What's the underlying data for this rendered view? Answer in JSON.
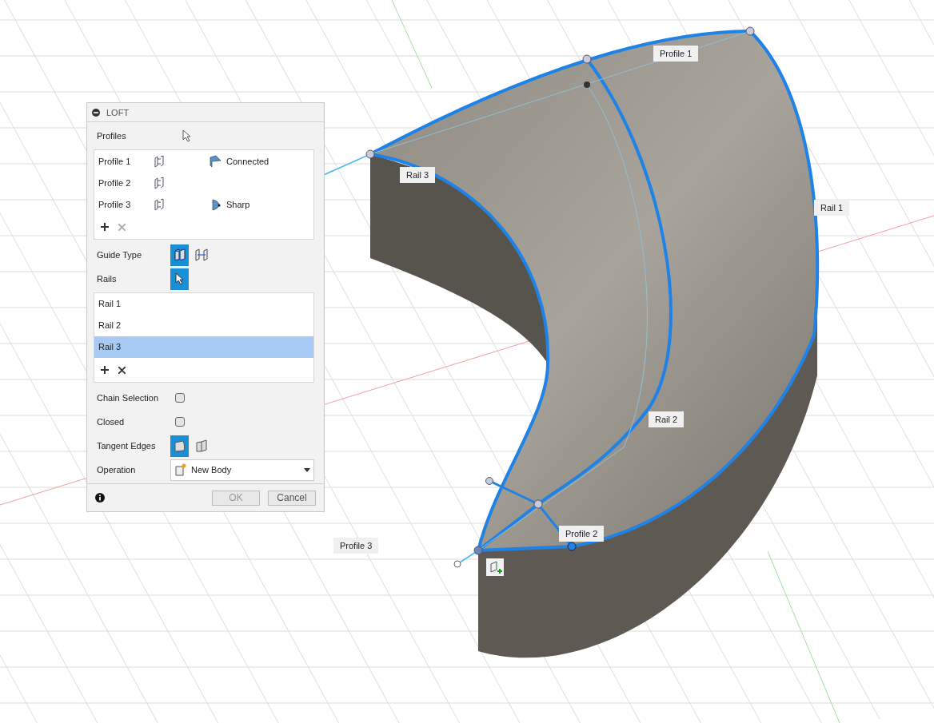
{
  "viewport": {
    "callouts": [
      {
        "label": "Profile 1"
      },
      {
        "label": "Rail 3"
      },
      {
        "label": "Rail 1"
      },
      {
        "label": "Rail 2"
      },
      {
        "label": "Profile 2"
      },
      {
        "label": "Profile 3"
      }
    ]
  },
  "dialog": {
    "title": "LOFT",
    "profiles_label": "Profiles",
    "profiles": [
      {
        "name": "Profile 1",
        "condition": "Connected",
        "kind": "connected"
      },
      {
        "name": "Profile 2"
      },
      {
        "name": "Profile 3",
        "condition": "Sharp",
        "kind": "sharp"
      }
    ],
    "guide_type": {
      "label": "Guide Type",
      "options": [
        {
          "kind": "rails",
          "selected": true
        },
        {
          "kind": "centerline",
          "selected": false
        }
      ]
    },
    "rails_label": "Rails",
    "rails": [
      {
        "name": "Rail 1",
        "selected": false
      },
      {
        "name": "Rail 2",
        "selected": false
      },
      {
        "name": "Rail 3",
        "selected": true
      }
    ],
    "chain_selection": {
      "label": "Chain Selection",
      "checked": false
    },
    "closed": {
      "label": "Closed",
      "checked": false
    },
    "tangent_edges": {
      "label": "Tangent Edges",
      "options": [
        {
          "kind": "merge",
          "selected": true
        },
        {
          "kind": "keep",
          "selected": false
        }
      ]
    },
    "operation": {
      "label": "Operation",
      "value": "New Body"
    },
    "buttons": [
      {
        "label": "OK",
        "disabled": true
      },
      {
        "label": "Cancel",
        "disabled": false
      }
    ]
  }
}
